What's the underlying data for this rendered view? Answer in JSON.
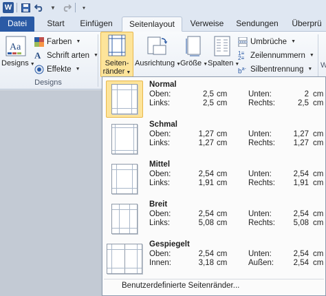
{
  "qat": {
    "app_logo": "W",
    "undo_icon": "undo-icon",
    "redo_icon": "redo-icon",
    "save_icon": "save-icon"
  },
  "tabs": [
    {
      "label": "Datei"
    },
    {
      "label": "Start"
    },
    {
      "label": "Einfügen"
    },
    {
      "label": "Seitenlayout"
    },
    {
      "label": "Verweise"
    },
    {
      "label": "Sendungen"
    },
    {
      "label": "Überprü"
    }
  ],
  "ribbon": {
    "designs_label": "Designs",
    "farben": "Farben",
    "schriftarten": "Schrift arten",
    "effekte": "Effekte",
    "group_designs": "Designs",
    "seitenraender_line1": "Seiten-",
    "seitenraender_line2": "ränder",
    "ausrichtung": "Ausrichtung",
    "groesse": "Größe",
    "spalten": "Spalten",
    "umbrueche": "Umbrüche",
    "zeilennummern": "Zeilennummern",
    "silbentrennung": "Silbentrennung"
  },
  "margins": {
    "options": [
      {
        "name": "Normal",
        "l1": "Oben:",
        "v1": "2,5",
        "l2": "Unten:",
        "v2": "2",
        "l3": "Links:",
        "v3": "2,5",
        "l4": "Rechts:",
        "v4": "2,5",
        "unit": "cm"
      },
      {
        "name": "Schmal",
        "l1": "Oben:",
        "v1": "1,27",
        "l2": "Unten:",
        "v2": "1,27",
        "l3": "Links:",
        "v3": "1,27",
        "l4": "Rechts:",
        "v4": "1,27",
        "unit": "cm"
      },
      {
        "name": "Mittel",
        "l1": "Oben:",
        "v1": "2,54",
        "l2": "Unten:",
        "v2": "2,54",
        "l3": "Links:",
        "v3": "1,91",
        "l4": "Rechts:",
        "v4": "1,91",
        "unit": "cm"
      },
      {
        "name": "Breit",
        "l1": "Oben:",
        "v1": "2,54",
        "l2": "Unten:",
        "v2": "2,54",
        "l3": "Links:",
        "v3": "5,08",
        "l4": "Rechts:",
        "v4": "5,08",
        "unit": "cm"
      },
      {
        "name": "Gespiegelt",
        "l1": "Oben:",
        "v1": "2,54",
        "l2": "Unten:",
        "v2": "2,54",
        "l3": "Innen:",
        "v3": "3,18",
        "l4": "Außen:",
        "v4": "2,54",
        "unit": "cm"
      }
    ],
    "custom_label": "Benutzerdefinierte Seitenränder..."
  },
  "colors": {
    "file_tab": "#2a5aa5",
    "selected_fill": "#fde49a",
    "selected_border": "#e8b74a"
  }
}
